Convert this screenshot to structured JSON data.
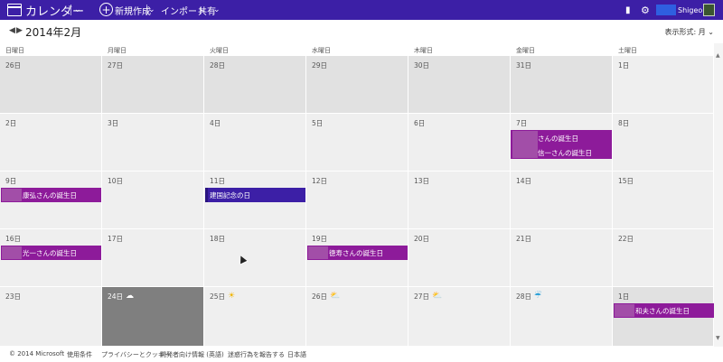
{
  "topbar": {
    "app_title": "カレンダー",
    "new_label": "新規作成",
    "import_label": "インポート",
    "share_label": "共有",
    "user_name": "Shigeo"
  },
  "subbar": {
    "month_title": "2014年2月",
    "view_mode": "表示形式: 月"
  },
  "weekdays": [
    "日曜日",
    "月曜日",
    "火曜日",
    "水曜日",
    "木曜日",
    "金曜日",
    "土曜日"
  ],
  "weeks": [
    [
      {
        "label": "26日",
        "other": true
      },
      {
        "label": "27日",
        "other": true
      },
      {
        "label": "28日",
        "other": true
      },
      {
        "label": "29日",
        "other": true
      },
      {
        "label": "30日",
        "other": true
      },
      {
        "label": "31日",
        "other": true
      },
      {
        "label": "1日",
        "other": false
      }
    ],
    [
      {
        "label": "2日"
      },
      {
        "label": "3日"
      },
      {
        "label": "4日"
      },
      {
        "label": "5日"
      },
      {
        "label": "6日"
      },
      {
        "label": "7日"
      },
      {
        "label": "8日"
      }
    ],
    [
      {
        "label": "9日"
      },
      {
        "label": "10日"
      },
      {
        "label": "11日"
      },
      {
        "label": "12日"
      },
      {
        "label": "13日"
      },
      {
        "label": "14日"
      },
      {
        "label": "15日"
      }
    ],
    [
      {
        "label": "16日"
      },
      {
        "label": "17日"
      },
      {
        "label": "18日"
      },
      {
        "label": "19日"
      },
      {
        "label": "20日"
      },
      {
        "label": "21日"
      },
      {
        "label": "22日"
      }
    ],
    [
      {
        "label": "23日"
      },
      {
        "label": "24日",
        "today": true,
        "weather": "cloud"
      },
      {
        "label": "25日",
        "weather": "sun"
      },
      {
        "label": "26日",
        "weather": "partly-cloudy"
      },
      {
        "label": "27日",
        "weather": "partly-cloudy"
      },
      {
        "label": "28日",
        "weather": "rain"
      },
      {
        "label": "1日",
        "other": true
      }
    ]
  ],
  "weather_icons": {
    "cloud": "cloud-icon",
    "sun": "sun-icon",
    "partly-cloudy": "partly-cloudy-icon",
    "rain": "rain-icon"
  },
  "events": {
    "feb7_a": "さんの誕生日",
    "feb7_b": "信一さんの誕生日",
    "feb9": "康弘さんの誕生日",
    "feb11": "建国記念の日",
    "feb16": "光一さんの誕生日",
    "feb19": "徳寿さんの誕生日",
    "mar1": "和夫さんの誕生日"
  },
  "colors": {
    "brand": "#3c1fa6",
    "birthday": "#8d1b9a",
    "holiday": "#3c1fa6",
    "today": "#7f7f7f"
  },
  "footer": [
    "© 2014 Microsoft",
    "使用条件",
    "プライバシーとクッキー",
    "開発者向け情報 (英語)",
    "迷惑行為を報告する",
    "日本語"
  ]
}
